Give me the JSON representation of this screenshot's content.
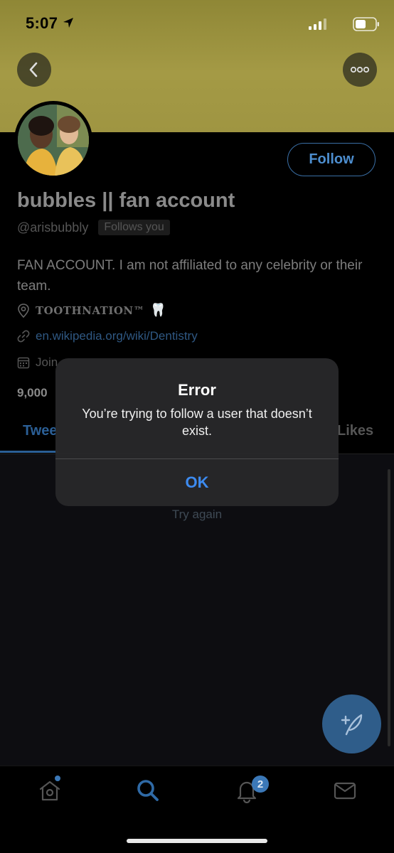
{
  "status_bar": {
    "time": "5:07"
  },
  "profile": {
    "name": "bubbles || fan account",
    "handle": "@arisbubbly",
    "follows_you": "Follows you",
    "follow_button": "Follow",
    "bio": "FAN ACCOUNT. I am not affiliated to any celebrity or their team.",
    "location": "TOOTHNATION™",
    "location_emoji": "🦷",
    "link": "en.wikipedia.org/wiki/Dentistry",
    "joined_partial": "Join",
    "counts_partial": "9,000"
  },
  "tabs": {
    "tweets": "Twee",
    "likes": "Likes"
  },
  "timeline": {
    "try_again": "Try again"
  },
  "alert": {
    "title": "Error",
    "message": "You’re trying to follow a user that doesn’t exist.",
    "ok_button": "OK"
  },
  "tab_bar": {
    "notification_count": "2"
  },
  "colors": {
    "accent": "#3d8bf0",
    "banner": "#a49a45",
    "follow": "#4d8ecf"
  }
}
